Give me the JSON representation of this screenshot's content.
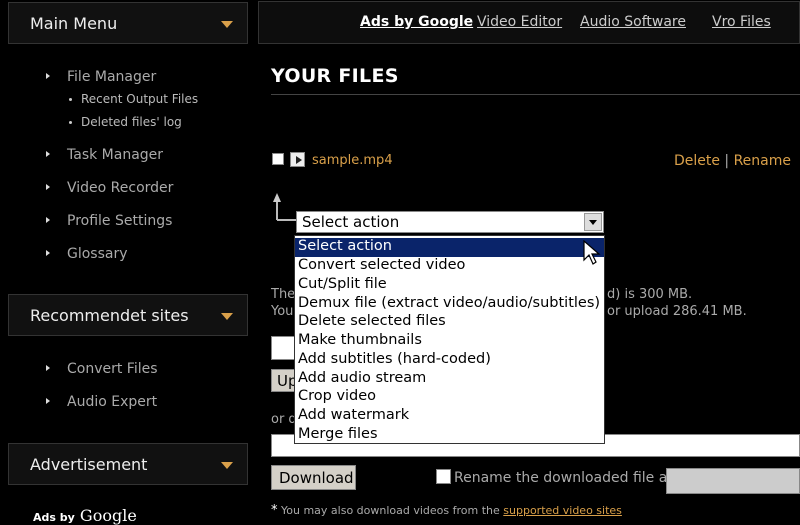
{
  "sidebar": {
    "main_menu": {
      "title": "Main Menu"
    },
    "items": [
      {
        "label": "File Manager"
      },
      {
        "label": "Task Manager"
      },
      {
        "label": "Video Recorder"
      },
      {
        "label": "Profile Settings"
      },
      {
        "label": "Glossary"
      }
    ],
    "subitems": [
      {
        "label": "Recent Output Files"
      },
      {
        "label": "Deleted files' log"
      }
    ],
    "recommended": {
      "title": "Recommendet sites",
      "items": [
        {
          "label": "Convert Files"
        },
        {
          "label": "Audio Expert"
        }
      ]
    },
    "advertisement": {
      "title": "Advertisement"
    },
    "ads_by": "Ads by",
    "ads_brand": "Google"
  },
  "topnav": {
    "ads_label": "Ads by Google",
    "links": [
      {
        "label": "Video Editor"
      },
      {
        "label": "Audio Software"
      },
      {
        "label": "Vro Files"
      }
    ]
  },
  "main": {
    "title": "YOUR FILES",
    "file": {
      "name": "sample.mp4",
      "delete": "Delete",
      "separator": "|",
      "rename": "Rename"
    },
    "select": {
      "value": "Select action",
      "options": [
        "Select action",
        "Convert selected video",
        "Cut/Split file",
        "Demux file (extract video/audio/subtitles)",
        "Delete selected files",
        "Make thumbnails",
        "Add subtitles (hard-coded)",
        "Add audio stream",
        "Crop video",
        "Add watermark",
        "Merge files"
      ]
    },
    "info_line1_left": "The",
    "info_line1_right": "d) is 300 MB.",
    "info_line2_left": "You",
    "info_line2_right": "or upload 286.41 MB.",
    "upload_button_partial": "Up",
    "or_text_partial": "or d",
    "download_button": "Download",
    "rename_label": "Rename the downloaded file as",
    "footnote_star": "*",
    "footnote_text": "You may also download videos from the",
    "footnote_link": "supported video sites"
  }
}
